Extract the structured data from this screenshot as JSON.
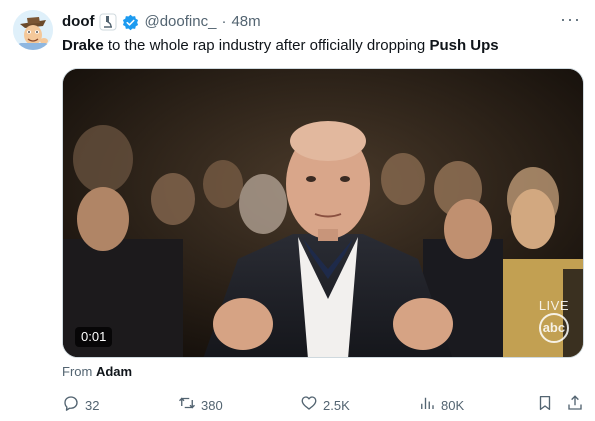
{
  "author": {
    "name": "doof",
    "handle": "@doofinc_",
    "separator": "·",
    "time": "48m",
    "verified": true,
    "affiliate_icon": "microscope-icon"
  },
  "more_label": "···",
  "text": {
    "part1_bold": "Drake",
    "part2": " to the whole rap industry after officially dropping ",
    "part3_bold": "Push Ups"
  },
  "media": {
    "duration": "0:01",
    "live_label": "LIVE",
    "network_logo": "abc"
  },
  "source": {
    "prefix": "From ",
    "name": "Adam"
  },
  "actions": {
    "replies": "32",
    "reposts": "380",
    "likes": "2.5K",
    "views": "80K"
  },
  "colors": {
    "accent": "#1d9bf0",
    "secondary_text": "#536471",
    "primary_text": "#0f1419"
  }
}
